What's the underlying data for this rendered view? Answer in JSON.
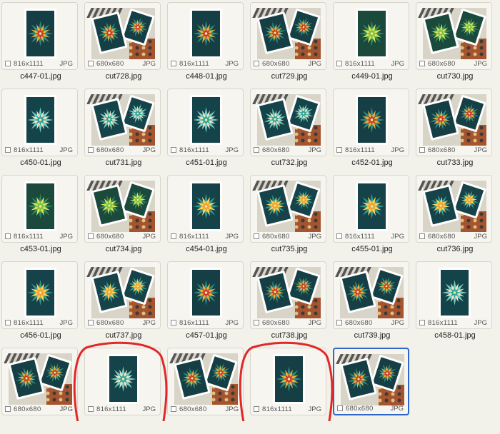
{
  "colors": {
    "background": "#f2f1ea",
    "selection_border": "#2f66c9",
    "annotation_red": "#e02828",
    "card_teal": "#17444a"
  },
  "items": [
    {
      "file": "c447-01.jpg",
      "dims": "816x1111",
      "format": "JPG",
      "kind": "card",
      "palette": "teal-red"
    },
    {
      "file": "cut728.jpg",
      "dims": "680x680",
      "format": "JPG",
      "kind": "photo",
      "palette": "teal-red"
    },
    {
      "file": "c448-01.jpg",
      "dims": "816x1111",
      "format": "JPG",
      "kind": "card",
      "palette": "teal-red"
    },
    {
      "file": "cut729.jpg",
      "dims": "680x680",
      "format": "JPG",
      "kind": "photo",
      "palette": "teal-red"
    },
    {
      "file": "c449-01.jpg",
      "dims": "816x1111",
      "format": "JPG",
      "kind": "card",
      "palette": "green"
    },
    {
      "file": "cut730.jpg",
      "dims": "680x680",
      "format": "JPG",
      "kind": "photo",
      "palette": "green"
    },
    {
      "file": "c450-01.jpg",
      "dims": "816x1111",
      "format": "JPG",
      "kind": "card",
      "palette": "teal"
    },
    {
      "file": "cut731.jpg",
      "dims": "680x680",
      "format": "JPG",
      "kind": "photo",
      "palette": "teal"
    },
    {
      "file": "c451-01.jpg",
      "dims": "816x1111",
      "format": "JPG",
      "kind": "card",
      "palette": "teal"
    },
    {
      "file": "cut732.jpg",
      "dims": "680x680",
      "format": "JPG",
      "kind": "photo",
      "palette": "teal"
    },
    {
      "file": "c452-01.jpg",
      "dims": "816x1111",
      "format": "JPG",
      "kind": "card",
      "palette": "teal-red"
    },
    {
      "file": "cut733.jpg",
      "dims": "680x680",
      "format": "JPG",
      "kind": "photo",
      "palette": "teal-red"
    },
    {
      "file": "c453-01.jpg",
      "dims": "816x1111",
      "format": "JPG",
      "kind": "card",
      "palette": "green"
    },
    {
      "file": "cut734.jpg",
      "dims": "680x680",
      "format": "JPG",
      "kind": "photo",
      "palette": "green"
    },
    {
      "file": "c454-01.jpg",
      "dims": "816x1111",
      "format": "JPG",
      "kind": "card",
      "palette": "orange"
    },
    {
      "file": "cut735.jpg",
      "dims": "680x680",
      "format": "JPG",
      "kind": "photo",
      "palette": "orange"
    },
    {
      "file": "c455-01.jpg",
      "dims": "816x1111",
      "format": "JPG",
      "kind": "card",
      "palette": "orange"
    },
    {
      "file": "cut736.jpg",
      "dims": "680x680",
      "format": "JPG",
      "kind": "photo",
      "palette": "orange"
    },
    {
      "file": "c456-01.jpg",
      "dims": "816x1111",
      "format": "JPG",
      "kind": "card",
      "palette": "orange"
    },
    {
      "file": "cut737.jpg",
      "dims": "680x680",
      "format": "JPG",
      "kind": "photo",
      "palette": "orange"
    },
    {
      "file": "c457-01.jpg",
      "dims": "816x1111",
      "format": "JPG",
      "kind": "card",
      "palette": "teal-red"
    },
    {
      "file": "cut738.jpg",
      "dims": "680x680",
      "format": "JPG",
      "kind": "photo",
      "palette": "teal-red"
    },
    {
      "file": "cut739.jpg",
      "dims": "680x680",
      "format": "JPG",
      "kind": "photo",
      "palette": "teal-red"
    },
    {
      "file": "c458-01.jpg",
      "dims": "816x1111",
      "format": "JPG",
      "kind": "card",
      "palette": "teal"
    },
    {
      "file": "",
      "dims": "680x680",
      "format": "JPG",
      "kind": "photo",
      "palette": "teal-red"
    },
    {
      "file": "",
      "dims": "816x1111",
      "format": "JPG",
      "kind": "card",
      "palette": "teal"
    },
    {
      "file": "",
      "dims": "680x680",
      "format": "JPG",
      "kind": "photo",
      "palette": "teal-red"
    },
    {
      "file": "",
      "dims": "816x1111",
      "format": "JPG",
      "kind": "card",
      "palette": "teal-red"
    },
    {
      "file": "",
      "dims": "680x680",
      "format": "JPG",
      "kind": "photo",
      "palette": "teal-red",
      "selected": true
    }
  ],
  "annotations": [
    "red-circle",
    "red-circle"
  ]
}
